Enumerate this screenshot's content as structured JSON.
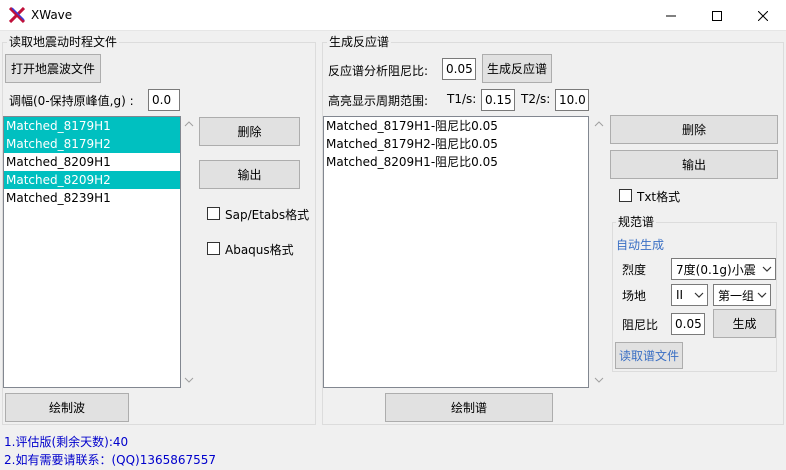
{
  "window": {
    "title": "XWave"
  },
  "left_group": {
    "title": "读取地震动时程文件",
    "open_button": "打开地震波文件",
    "amplitude_label": "调幅(0-保持原峰值,g) :",
    "amplitude_value": "0.0",
    "waves": [
      {
        "name": "Matched_8179H1",
        "selected": true
      },
      {
        "name": "Matched_8179H2",
        "selected": true
      },
      {
        "name": "Matched_8209H1",
        "selected": false
      },
      {
        "name": "Matched_8209H2",
        "selected": true
      },
      {
        "name": "Matched_8239H1",
        "selected": false
      }
    ],
    "delete_button": "删除",
    "export_button": "输出",
    "sap_etabs_label": "Sap/Etabs格式",
    "abaqus_label": "Abaqus格式",
    "plot_wave_button": "绘制波"
  },
  "right_group": {
    "title": "生成反应谱",
    "damping_label": "反应谱分析阻尼比:",
    "damping_value": "0.05",
    "generate_button": "生成反应谱",
    "period_range_label": "高亮显示周期范围:",
    "t1_label": "T1/s:",
    "t1_value": "0.15",
    "t2_label": "T2/s:",
    "t2_value": "10.0",
    "spectra": [
      "Matched_8179H1-阻尼比0.05",
      "Matched_8179H2-阻尼比0.05",
      "Matched_8209H1-阻尼比0.05"
    ],
    "delete_button": "删除",
    "export_button": "输出",
    "txt_label": "Txt格式",
    "plot_spectrum_button": "绘制谱"
  },
  "code_spectrum": {
    "title": "规范谱",
    "auto_label": "自动生成",
    "intensity_label": "烈度",
    "intensity_value": "7度(0.1g)小震",
    "site_label": "场地",
    "site_value": "II",
    "group_value": "第一组",
    "damping_label": "阻尼比",
    "damping_value": "0.05",
    "generate_button": "生成",
    "read_button": "读取谱文件"
  },
  "status": {
    "line1": "1.评估版(剩余天数):40",
    "line2": "2.如有需要请联系：(QQ)1365867557"
  },
  "colors": {
    "selection": "#00c0c0",
    "status_text": "#0000cc",
    "link": "#3a6fc4"
  }
}
